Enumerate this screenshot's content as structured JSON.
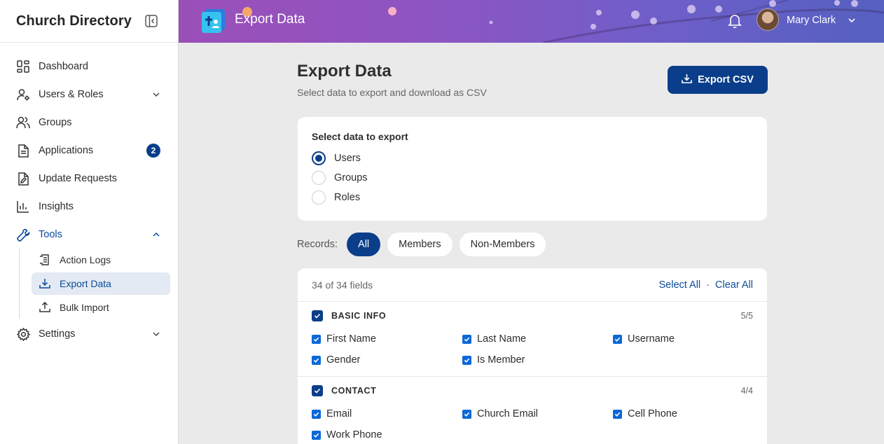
{
  "app": {
    "title": "Church Directory"
  },
  "sidebar": {
    "items": [
      {
        "label": "Dashboard"
      },
      {
        "label": "Users & Roles"
      },
      {
        "label": "Groups"
      },
      {
        "label": "Applications",
        "badge": "2"
      },
      {
        "label": "Update Requests"
      },
      {
        "label": "Insights"
      },
      {
        "label": "Tools"
      },
      {
        "label": "Settings"
      }
    ],
    "tools_sub": [
      {
        "label": "Action Logs"
      },
      {
        "label": "Export Data"
      },
      {
        "label": "Bulk Import"
      }
    ]
  },
  "header": {
    "title": "Export Data",
    "user_name": "Mary Clark"
  },
  "main": {
    "title": "Export Data",
    "subtitle": "Select data to export and download as CSV",
    "export_button": "Export CSV",
    "select_heading": "Select data to export",
    "data_options": [
      {
        "label": "Users",
        "selected": true
      },
      {
        "label": "Groups",
        "selected": false
      },
      {
        "label": "Roles",
        "selected": false
      }
    ],
    "records_label": "Records:",
    "record_filters": [
      {
        "label": "All",
        "selected": true
      },
      {
        "label": "Members",
        "selected": false
      },
      {
        "label": "Non-Members",
        "selected": false
      }
    ],
    "fields_count": "34 of 34 fields",
    "select_all": "Select All",
    "separator": "·",
    "clear_all": "Clear All",
    "sections": [
      {
        "title": "BASIC INFO",
        "count": "5/5",
        "fields": [
          "First Name",
          "Last Name",
          "Username",
          "Gender",
          "Is Member"
        ]
      },
      {
        "title": "CONTACT",
        "count": "4/4",
        "fields": [
          "Email",
          "Church Email",
          "Cell Phone",
          "Work Phone"
        ]
      }
    ]
  },
  "colors": {
    "accent": "#0b3e8a",
    "checkbox": "#0b68d8",
    "header_gradient_start": "#9b4fb8",
    "header_gradient_end": "#5560c0"
  }
}
